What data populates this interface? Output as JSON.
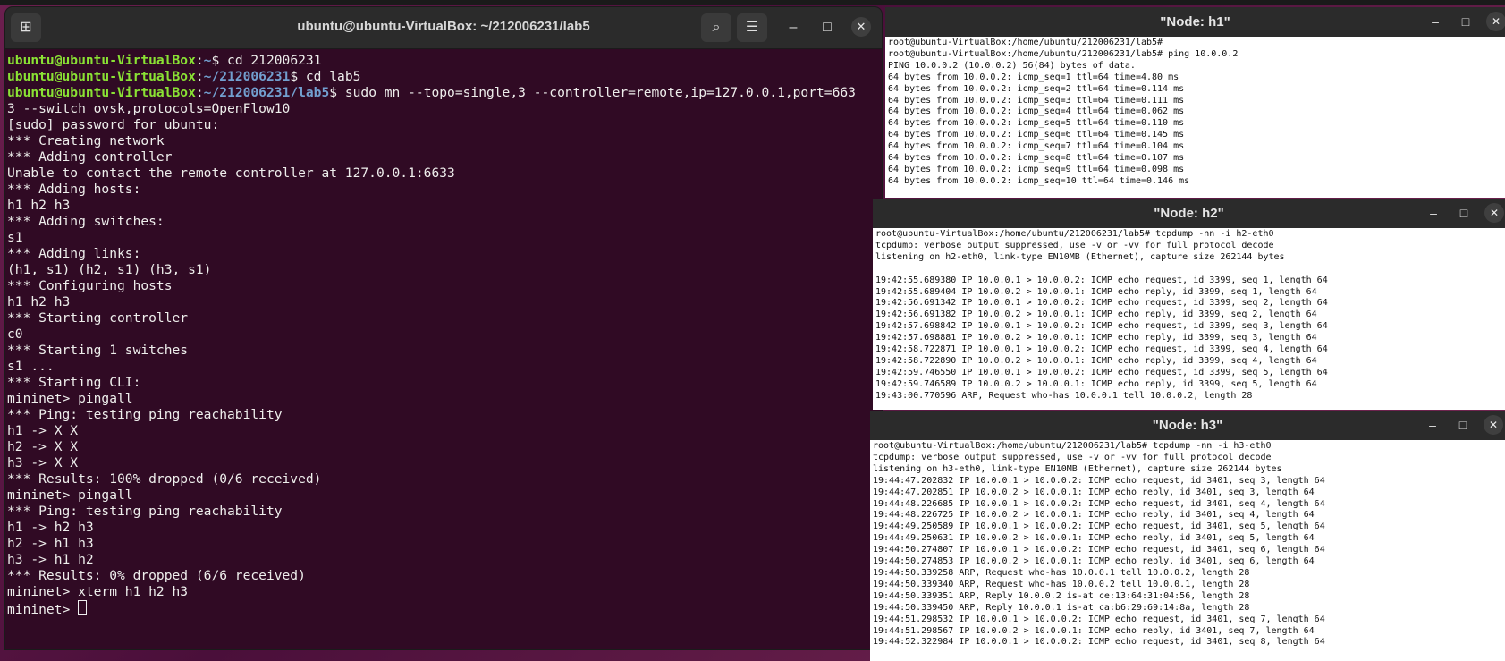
{
  "terminal": {
    "title": "ubuntu@ubuntu-VirtualBox: ~/212006231/lab5",
    "prompt_user": "ubuntu@ubuntu-VirtualBox",
    "prompts": [
      {
        "path": "~",
        "cmd": "$ cd 212006231"
      },
      {
        "path": "~/212006231",
        "cmd": "$ cd lab5"
      },
      {
        "path": "~/212006231/lab5",
        "cmd": "$ sudo mn --topo=single,3 --controller=remote,ip=127.0.0.1,port=663"
      }
    ],
    "output": [
      "3 --switch ovsk,protocols=OpenFlow10",
      "[sudo] password for ubuntu:",
      "*** Creating network",
      "*** Adding controller",
      "Unable to contact the remote controller at 127.0.0.1:6633",
      "*** Adding hosts:",
      "h1 h2 h3",
      "*** Adding switches:",
      "s1",
      "*** Adding links:",
      "(h1, s1) (h2, s1) (h3, s1)",
      "*** Configuring hosts",
      "h1 h2 h3",
      "*** Starting controller",
      "c0",
      "*** Starting 1 switches",
      "s1 ...",
      "*** Starting CLI:",
      "mininet> pingall",
      "*** Ping: testing ping reachability",
      "h1 -> X X",
      "h2 -> X X",
      "h3 -> X X",
      "*** Results: 100% dropped (0/6 received)",
      "mininet> pingall",
      "*** Ping: testing ping reachability",
      "h1 -> h2 h3",
      "h2 -> h1 h3",
      "h3 -> h1 h2",
      "*** Results: 0% dropped (6/6 received)",
      "mininet> xterm h1 h2 h3"
    ],
    "last_prompt": "mininet> "
  },
  "h1": {
    "title": "\"Node: h1\"",
    "lines": [
      "root@ubuntu-VirtualBox:/home/ubuntu/212006231/lab5#",
      "root@ubuntu-VirtualBox:/home/ubuntu/212006231/lab5# ping 10.0.0.2",
      "PING 10.0.0.2 (10.0.0.2) 56(84) bytes of data.",
      "64 bytes from 10.0.0.2: icmp_seq=1 ttl=64 time=4.80 ms",
      "64 bytes from 10.0.0.2: icmp_seq=2 ttl=64 time=0.114 ms",
      "64 bytes from 10.0.0.2: icmp_seq=3 ttl=64 time=0.111 ms",
      "64 bytes from 10.0.0.2: icmp_seq=4 ttl=64 time=0.062 ms",
      "64 bytes from 10.0.0.2: icmp_seq=5 ttl=64 time=0.110 ms",
      "64 bytes from 10.0.0.2: icmp_seq=6 ttl=64 time=0.145 ms",
      "64 bytes from 10.0.0.2: icmp_seq=7 ttl=64 time=0.104 ms",
      "64 bytes from 10.0.0.2: icmp_seq=8 ttl=64 time=0.107 ms",
      "64 bytes from 10.0.0.2: icmp_seq=9 ttl=64 time=0.098 ms",
      "64 bytes from 10.0.0.2: icmp_seq=10 ttl=64 time=0.146 ms"
    ]
  },
  "h2": {
    "title": "\"Node: h2\"",
    "lines": [
      "root@ubuntu-VirtualBox:/home/ubuntu/212006231/lab5# tcpdump -nn -i h2-eth0",
      "tcpdump: verbose output suppressed, use -v or -vv for full protocol decode",
      "listening on h2-eth0, link-type EN10MB (Ethernet), capture size 262144 bytes",
      "",
      "19:42:55.689380 IP 10.0.0.1 > 10.0.0.2: ICMP echo request, id 3399, seq 1, length 64",
      "19:42:55.689404 IP 10.0.0.2 > 10.0.0.1: ICMP echo reply, id 3399, seq 1, length 64",
      "19:42:56.691342 IP 10.0.0.1 > 10.0.0.2: ICMP echo request, id 3399, seq 2, length 64",
      "19:42:56.691382 IP 10.0.0.2 > 10.0.0.1: ICMP echo reply, id 3399, seq 2, length 64",
      "19:42:57.698842 IP 10.0.0.1 > 10.0.0.2: ICMP echo request, id 3399, seq 3, length 64",
      "19:42:57.698881 IP 10.0.0.2 > 10.0.0.1: ICMP echo reply, id 3399, seq 3, length 64",
      "19:42:58.722871 IP 10.0.0.1 > 10.0.0.2: ICMP echo request, id 3399, seq 4, length 64",
      "19:42:58.722890 IP 10.0.0.2 > 10.0.0.1: ICMP echo reply, id 3399, seq 4, length 64",
      "19:42:59.746550 IP 10.0.0.1 > 10.0.0.2: ICMP echo request, id 3399, seq 5, length 64",
      "19:42:59.746589 IP 10.0.0.2 > 10.0.0.1: ICMP echo reply, id 3399, seq 5, length 64",
      "19:43:00.770596 ARP, Request who-has 10.0.0.1 tell 10.0.0.2, length 28"
    ]
  },
  "h3": {
    "title": "\"Node: h3\"",
    "lines": [
      "root@ubuntu-VirtualBox:/home/ubuntu/212006231/lab5# tcpdump -nn -i h3-eth0",
      "tcpdump: verbose output suppressed, use -v or -vv for full protocol decode",
      "listening on h3-eth0, link-type EN10MB (Ethernet), capture size 262144 bytes",
      "19:44:47.202832 IP 10.0.0.1 > 10.0.0.2: ICMP echo request, id 3401, seq 3, length 64",
      "19:44:47.202851 IP 10.0.0.2 > 10.0.0.1: ICMP echo reply, id 3401, seq 3, length 64",
      "19:44:48.226685 IP 10.0.0.1 > 10.0.0.2: ICMP echo request, id 3401, seq 4, length 64",
      "19:44:48.226725 IP 10.0.0.2 > 10.0.0.1: ICMP echo reply, id 3401, seq 4, length 64",
      "19:44:49.250589 IP 10.0.0.1 > 10.0.0.2: ICMP echo request, id 3401, seq 5, length 64",
      "19:44:49.250631 IP 10.0.0.2 > 10.0.0.1: ICMP echo reply, id 3401, seq 5, length 64",
      "19:44:50.274807 IP 10.0.0.1 > 10.0.0.2: ICMP echo request, id 3401, seq 6, length 64",
      "19:44:50.274853 IP 10.0.0.2 > 10.0.0.1: ICMP echo reply, id 3401, seq 6, length 64",
      "19:44:50.339258 ARP, Request who-has 10.0.0.1 tell 10.0.0.2, length 28",
      "19:44:50.339340 ARP, Request who-has 10.0.0.2 tell 10.0.0.1, length 28",
      "19:44:50.339351 ARP, Reply 10.0.0.2 is-at ce:13:64:31:04:56, length 28",
      "19:44:50.339450 ARP, Reply 10.0.0.1 is-at ca:b6:29:69:14:8a, length 28",
      "19:44:51.298532 IP 10.0.0.1 > 10.0.0.2: ICMP echo request, id 3401, seq 7, length 64",
      "19:44:51.298567 IP 10.0.0.2 > 10.0.0.1: ICMP echo reply, id 3401, seq 7, length 64",
      "19:44:52.322984 IP 10.0.0.1 > 10.0.0.2: ICMP echo request, id 3401, seq 8, length 64"
    ]
  }
}
